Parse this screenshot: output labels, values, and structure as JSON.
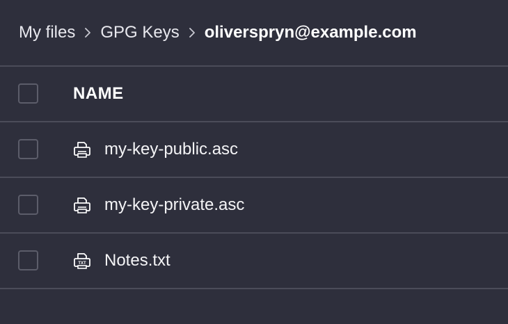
{
  "breadcrumb": {
    "items": [
      {
        "label": "My files",
        "icon": null
      },
      {
        "label": "GPG Keys",
        "icon": null
      },
      {
        "label": "oliverspryn@example.com",
        "current": true
      }
    ],
    "separator_icon": "chevron-right-icon"
  },
  "table": {
    "columns": [
      {
        "label": "NAME"
      }
    ],
    "rows": [
      {
        "name": "my-key-public.asc",
        "icon": "printer-file-icon",
        "icon_text": ""
      },
      {
        "name": "my-key-private.asc",
        "icon": "printer-file-icon",
        "icon_text": ""
      },
      {
        "name": "Notes.txt",
        "icon": "txt-file-icon",
        "icon_text": "TXT"
      }
    ]
  },
  "colors": {
    "background": "#2e2f3c",
    "divider": "#4b4c59",
    "checkbox_border": "#5c5d6a",
    "text": "#ffffff"
  }
}
